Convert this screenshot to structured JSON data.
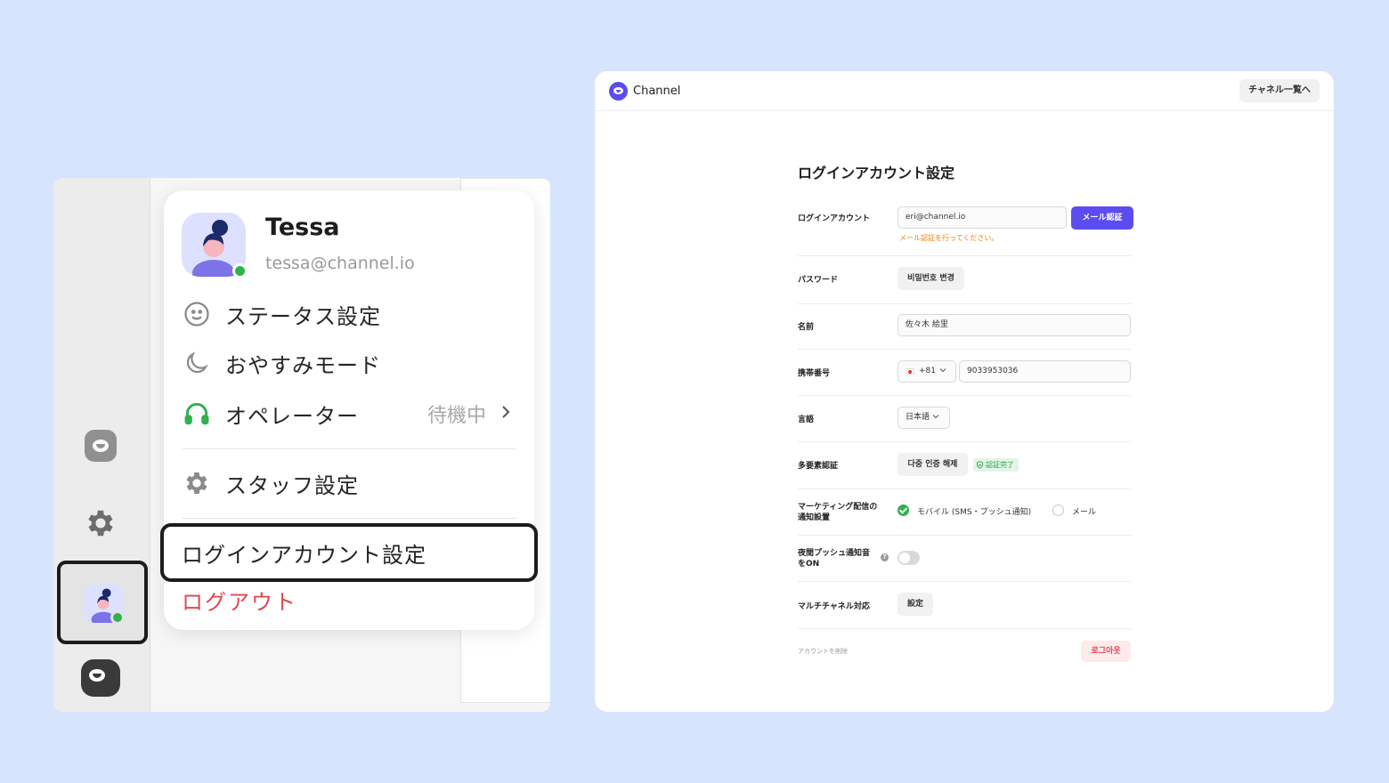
{
  "popup": {
    "name": "Tessa",
    "email": "tessa@channel.io",
    "menu": {
      "status": "ステータス設定",
      "donotdisturb": "おやすみモード",
      "operator": "オペレーター",
      "operator_status": "待機中",
      "staff_settings": "スタッフ設定",
      "login_account": "ログインアカウント設定",
      "logout": "ログアウト"
    }
  },
  "header": {
    "brand": "Channel",
    "channel_list_button": "チャネル一覧へ"
  },
  "settings": {
    "title": "ログインアカウント設定",
    "login_account": {
      "label": "ログインアカウント",
      "value": "eri@channel.io",
      "verify_button": "メール認証",
      "warning": "メール認証を行ってください。"
    },
    "password": {
      "label": "パスワード",
      "button": "비밀번호 변경"
    },
    "name": {
      "label": "名前",
      "value": "佐々木 絵里"
    },
    "phone": {
      "label": "携帯番号",
      "country_code": "+81",
      "value": "9033953036"
    },
    "language": {
      "label": "言語",
      "value": "日本語"
    },
    "mfa": {
      "label": "多要素認証",
      "button": "다중 인증 해제",
      "badge": "認証完了"
    },
    "marketing": {
      "label_line1": "マーケティング配信の",
      "label_line2": "通知設置",
      "option_mobile": "モバイル (SMS・プッシュ通知)",
      "option_mail": "メール"
    },
    "night_push": {
      "label_line1": "夜間プッシュ通知音",
      "label_line2": "をON",
      "help": "?"
    },
    "multichannel": {
      "label": "マルチチャネル対応",
      "button": "設定"
    },
    "delete_account": "アカウントを削除",
    "logout_button": "로그아웃"
  },
  "colors": {
    "background": "#d6e4fd",
    "accent": "#5b4cf0",
    "online": "#2fb14d",
    "danger": "#e0464f",
    "warning": "#e8870c"
  }
}
